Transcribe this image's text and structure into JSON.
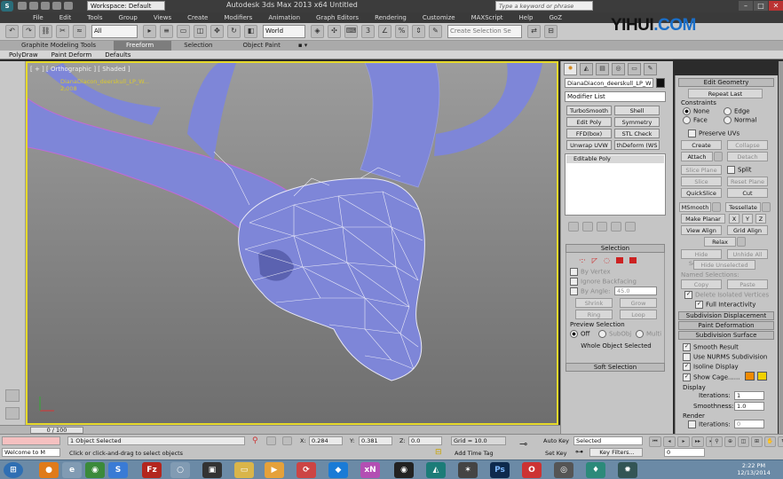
{
  "app": {
    "workspace": "Workspace: Default",
    "title": "Autodesk 3ds Max  2013 x64     Untitled",
    "search_placeholder": "Type a keyword or phrase"
  },
  "brand": "YIHUI",
  "brand2": ".COM",
  "menu": [
    "File",
    "Edit",
    "Tools",
    "Group",
    "Views",
    "Create",
    "Modifiers",
    "Animation",
    "Graph Editors",
    "Rendering",
    "Customize",
    "MAXScript",
    "Help",
    "GoZ"
  ],
  "toolbar": {
    "filter": "All",
    "refcoord": "World",
    "selection_set": "Create Selection Se"
  },
  "ribbon": {
    "tabs": [
      "Graphite Modeling Tools",
      "Freeform",
      "Selection",
      "Object Paint"
    ],
    "active_tab": "Freeform",
    "subtabs": [
      "PolyDraw",
      "Paint Deform",
      "Defaults"
    ]
  },
  "viewport": {
    "label": "[ + ] [ Orthographic ] [ Shaded ]",
    "object_label": "DianaDiacon_deerskull_LP_W...",
    "object_sub": "2,008"
  },
  "command_panel": {
    "object_name": "DianaDiacon_deerskull_LP_W",
    "modifier_list": "Modifier List",
    "modifier_buttons": [
      "TurboSmooth",
      "Shell",
      "Edit Poly",
      "Symmetry",
      "FFD(box)",
      "STL Check",
      "Unwrap UVW",
      "thDeform (WS"
    ],
    "stack_item": "Editable Poly",
    "selection": {
      "header": "Selection",
      "by_vertex": "By Vertex",
      "ignore_backfacing": "Ignore Backfacing",
      "by_angle": "By Angle:",
      "angle_value": "45.0",
      "shrink": "Shrink",
      "grow": "Grow",
      "ring": "Ring",
      "loop": "Loop",
      "preview_label": "Preview Selection",
      "preview_off": "Off",
      "preview_subobj": "SubObj",
      "preview_multi": "Multi",
      "status": "Whole Object Selected"
    },
    "soft_selection": "Soft Selection"
  },
  "edit_geometry": {
    "header": "Edit Geometry",
    "repeat_last": "Repeat Last",
    "constraints": "Constraints",
    "none": "None",
    "edge": "Edge",
    "face": "Face",
    "normal": "Normal",
    "preserve_uvs": "Preserve UVs",
    "create": "Create",
    "collapse": "Collapse",
    "attach": "Attach",
    "detach": "Detach",
    "slice_plane": "Slice Plane",
    "split": "Split",
    "slice": "Slice",
    "reset_plane": "Reset Plane",
    "quickslice": "QuickSlice",
    "cut": "Cut",
    "msmooth": "MSmooth",
    "tessellate": "Tessellate",
    "make_planar": "Make Planar",
    "x": "X",
    "y": "Y",
    "z": "Z",
    "view_align": "View Align",
    "grid_align": "Grid Align",
    "relax": "Relax",
    "hide_selected": "Hide Selected",
    "unhide_all": "Unhide All",
    "hide_unselected": "Hide Unselected",
    "named_selections": "Named Selections:",
    "copy": "Copy",
    "paste": "Paste",
    "delete_isolated": "Delete Isolated Vertices",
    "full_interactivity": "Full Interactivity"
  },
  "subdivision": {
    "displacement": "Subdivision Displacement",
    "paint_deformation": "Paint Deformation",
    "surface": "Subdivision Surface",
    "smooth_result": "Smooth Result",
    "use_nurms": "Use NURMS Subdivision",
    "isoline": "Isoline Display",
    "show_cage": "Show Cage......",
    "display": "Display",
    "iterations_label": "Iterations:",
    "iterations": "1",
    "smoothness_label": "Smoothness:",
    "smoothness": "1.0",
    "render": "Render",
    "render_iterations": "0"
  },
  "colors": {
    "cage1": "#f08a00",
    "cage2": "#f0d000",
    "viewport_border": "#e6d92a",
    "mesh": "#7e86d8"
  },
  "timeline": {
    "slider": "0 / 100"
  },
  "status": {
    "selected": "1 Object Selected",
    "prompt": "Click or click-and-drag to select objects",
    "x_label": "X:",
    "x": "0.284",
    "y_label": "Y:",
    "y": "0.381",
    "z_label": "Z:",
    "z": "0.0",
    "grid": "Grid = 10.0",
    "add_time_tag": "Add Time Tag",
    "auto_key": "Auto Key",
    "set_key": "Set Key",
    "key_mode": "Selected",
    "key_filters": "Key Filters...",
    "frame": "0",
    "welcome": "Welcome to M"
  },
  "taskbar": {
    "time": "2:22 PM",
    "date": "12/13/2014"
  }
}
